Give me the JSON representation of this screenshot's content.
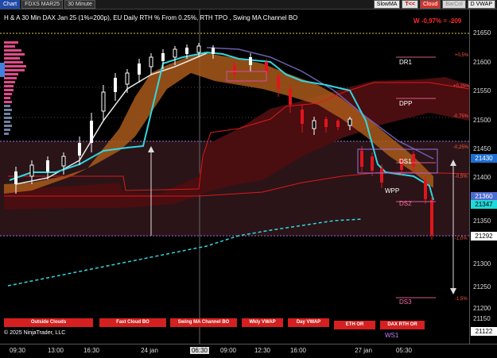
{
  "toolbar": {
    "chart_label": "Chart",
    "instrument": "FDXS MAR25",
    "interval": "30 Minute",
    "buttons": [
      "SlowMA",
      "T<<",
      "Cloud",
      "BarCol",
      "D VWAP"
    ]
  },
  "title": "H & A 30 Min DAX Jan 25  (1%=200p), EU Daily RTH % From 0.25%, RTH TPO , Swing MA Channel BO",
  "w_badge": "W -0,97% = -209",
  "y_ticks": [
    "21650",
    "21600",
    "21550",
    "21500",
    "21450",
    "21400",
    "21350",
    "21300",
    "21250",
    "21200",
    "21150"
  ],
  "price_badges": [
    {
      "label": "21430",
      "bg": "#1f6fd0",
      "fg": "#ffffff"
    },
    {
      "label": "21360",
      "bg": "#4f6bd0",
      "fg": "#ffffff"
    },
    {
      "label": "21347",
      "bg": "#20d8d8",
      "fg": "#000000"
    },
    {
      "label": "21292",
      "bg": "#ffffff",
      "fg": "#000000"
    },
    {
      "label": "21122",
      "bg": "#ffffff",
      "fg": "#000000"
    }
  ],
  "x_ticks": [
    "09:30",
    "13:00",
    "16:30",
    "24 jan",
    "06:30",
    "09:00",
    "12:30",
    "16:00",
    "27 jan",
    "05:30"
  ],
  "levels": [
    "DR1",
    "DPP",
    "DS1",
    "WPP",
    "DS2",
    "DS3"
  ],
  "percent_labels": [
    "+0,5%",
    "+0,25%",
    "-0,75%",
    "-0,25%",
    "-0,5%",
    "-1,0%",
    "-1,5%"
  ],
  "bottom_buttons": [
    "Outside Clouds",
    "Fast Cloud BO",
    "Swing MA Channel BO",
    "Wkly VWAP",
    "Day VWAP",
    "ETH OR",
    "DAX RTH OR"
  ],
  "ws1_label": "WS1",
  "copyright": "© 2025 NinjaTrader, LLC",
  "colors": {
    "bull": "#ffffff",
    "bear": "#e0161b",
    "cloud_orange": "#c8751e",
    "cloud_red": "#6a1313",
    "cyan": "#30d8e0",
    "purple": "#6a5fb0",
    "background": "#000000"
  }
}
